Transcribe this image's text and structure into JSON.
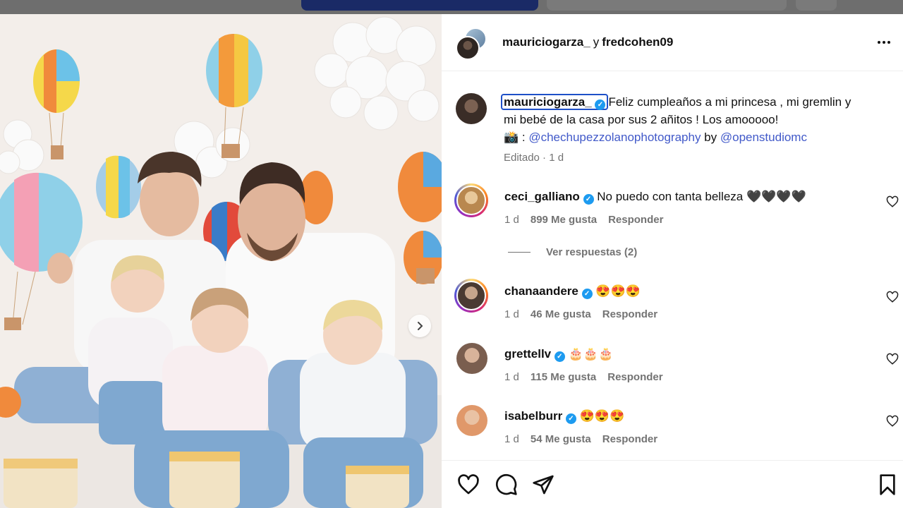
{
  "post": {
    "header": {
      "user1": "mauriciogarza_",
      "joiner": "y",
      "user2": "fredcohen09",
      "avatar_icon": "double-avatar",
      "more_icon": "more-horizontal-icon"
    },
    "caption": {
      "username": "mauriciogarza_",
      "text_line1": "Feliz cumpleaños a mi princesa , mi gremlin y",
      "text_line2": "mi bebé de la casa por sus 2 añitos ! Los amooooo!",
      "camera_emoji": "📸",
      "credit_sep": " : ",
      "credit_link1": "@chechupezzolanophotography",
      "credit_by": " by ",
      "credit_link2": "@openstudiomc",
      "meta": "Editado · 1 d"
    },
    "comments": [
      {
        "username": "ceci_galliano",
        "text": "No puedo con tanta belleza 🖤🖤🖤🖤",
        "time": "1 d",
        "likes": "899 Me gusta",
        "reply": "Responder",
        "avatar_color": "#d9b27a"
      },
      {
        "username": "chanaandere",
        "text": "😍😍😍",
        "time": "1 d",
        "likes": "46 Me gusta",
        "reply": "Responder",
        "avatar_color": "#8a6f5c"
      },
      {
        "username": "grettellv",
        "text": "🎂🎂🎂",
        "time": "1 d",
        "likes": "115 Me gusta",
        "reply": "Responder",
        "avatar_color": "#a88b78"
      },
      {
        "username": "isabelburr",
        "text": "😍😍😍",
        "time": "1 d",
        "likes": "54 Me gusta",
        "reply": "Responder",
        "avatar_color": "#e0986a"
      }
    ],
    "view_replies": "Ver respuestas (2)",
    "actions": {
      "like_icon": "heart-icon",
      "comment_icon": "comment-icon",
      "share_icon": "send-icon",
      "save_icon": "bookmark-icon"
    },
    "carousel_next_icon": "chevron-right-icon"
  },
  "colors": {
    "verified": "#1d9bf0",
    "link": "#4159c9",
    "focus_outline": "#1e50c8",
    "muted": "#737373"
  }
}
